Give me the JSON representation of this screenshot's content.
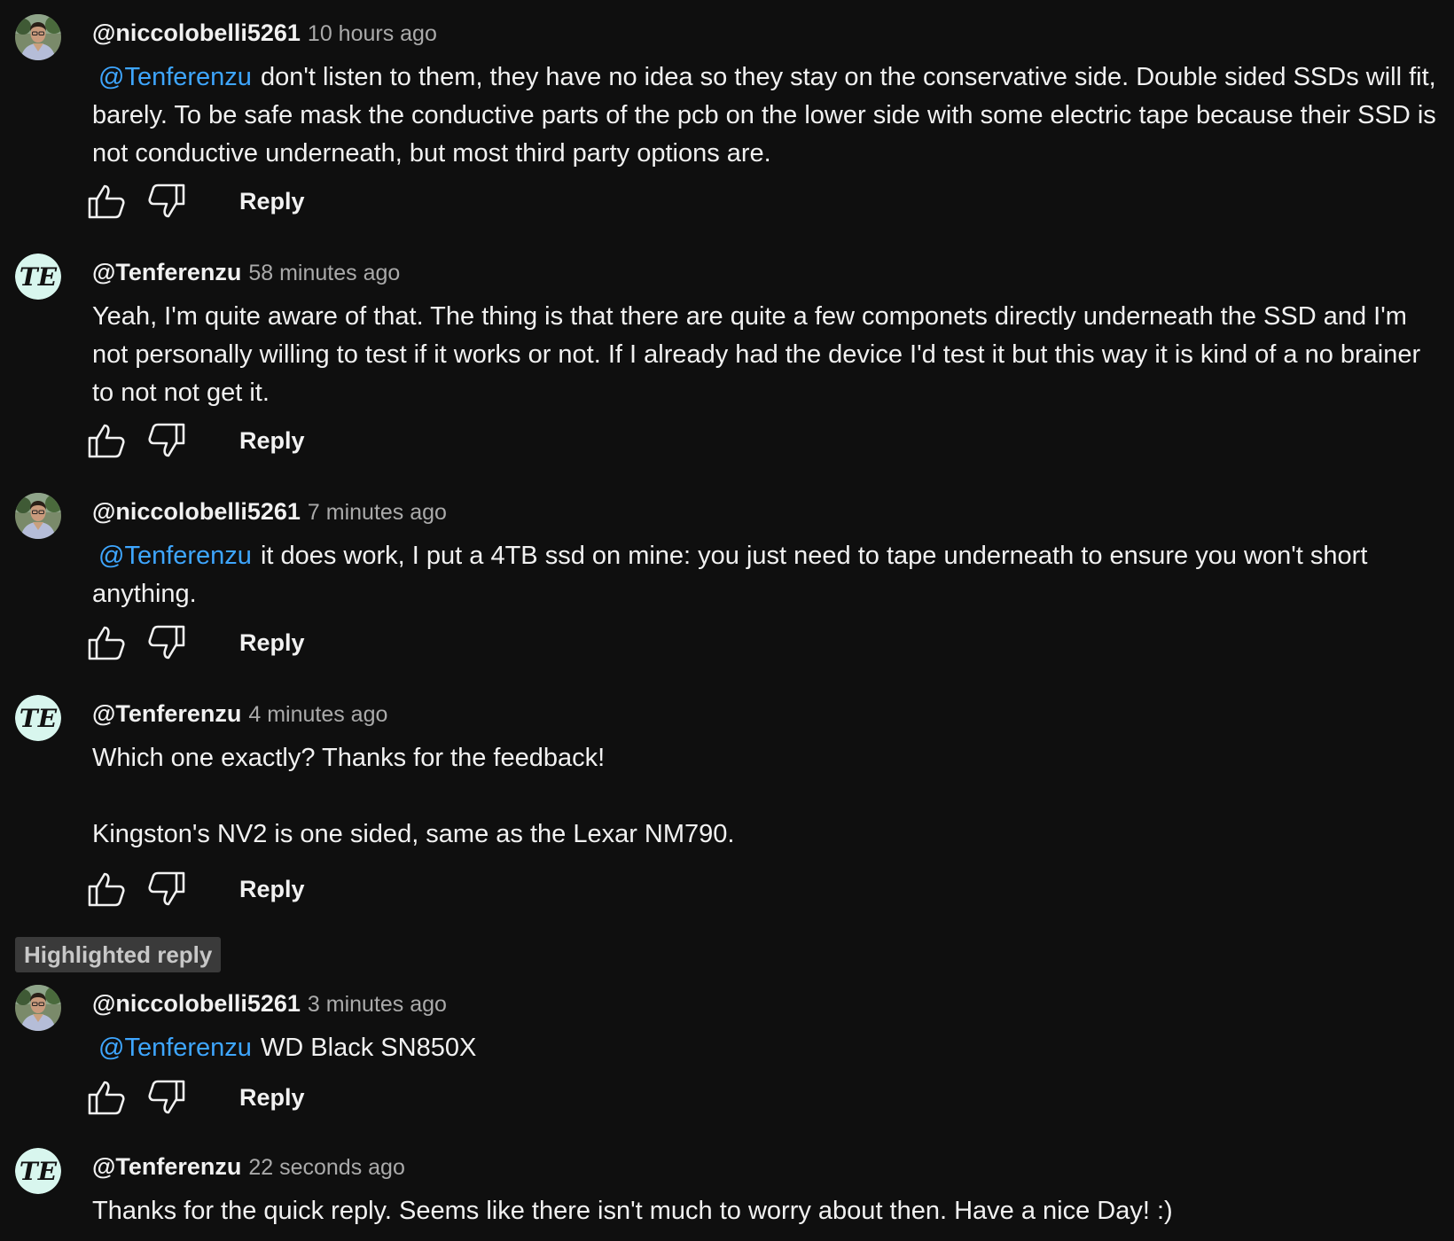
{
  "colors": {
    "background": "#0f0f0f",
    "text": "#f1f1f1",
    "muted": "#aaaaaa",
    "mention": "#3ea6ff",
    "highlight_bg": "#3a3a3a",
    "te_avatar_bg": "#d8f6ee"
  },
  "reply_label": "Reply",
  "highlight_label": "Highlighted reply",
  "comments": [
    {
      "author": "@niccolobelli5261",
      "time": "10 hours ago",
      "avatar": "user-photo-avatar",
      "mention": "@Tenferenzu",
      "text": "don't listen to them, they have no idea so they stay on the conservative side. Double sided SSDs will fit, barely. To be safe mask the conductive parts of the pcb on the lower side with some electric tape because their SSD is not conductive underneath, but most third party options are."
    },
    {
      "author": "@Tenferenzu",
      "time": "58 minutes ago",
      "avatar": "te-logo-avatar",
      "avatar_text": "TE",
      "text": "Yeah, I'm quite aware of that. The thing is that there are quite a few componets directly underneath the SSD and I'm not personally willing to test if it works or not. If I already had the device I'd test it but this way it is kind of a no brainer to not not get it."
    },
    {
      "author": "@niccolobelli5261",
      "time": "7 minutes ago",
      "avatar": "user-photo-avatar",
      "mention": "@Tenferenzu",
      "text": "it does work, I put a 4TB ssd on mine: you just need to tape underneath to ensure you won't short anything."
    },
    {
      "author": "@Tenferenzu",
      "time": "4 minutes ago",
      "avatar": "te-logo-avatar",
      "avatar_text": "TE",
      "text": "Which one exactly? Thanks for the feedback!",
      "text2": "Kingston's NV2 is one sided, same as the Lexar NM790."
    },
    {
      "author": "@niccolobelli5261",
      "time": "3 minutes ago",
      "avatar": "user-photo-avatar",
      "mention": "@Tenferenzu",
      "text": "WD Black SN850X"
    },
    {
      "author": "@Tenferenzu",
      "time": "22 seconds ago",
      "avatar": "te-logo-avatar",
      "avatar_text": "TE",
      "text": "Thanks for the quick reply. Seems like there isn't much to worry about then. Have a nice Day! :)"
    }
  ]
}
